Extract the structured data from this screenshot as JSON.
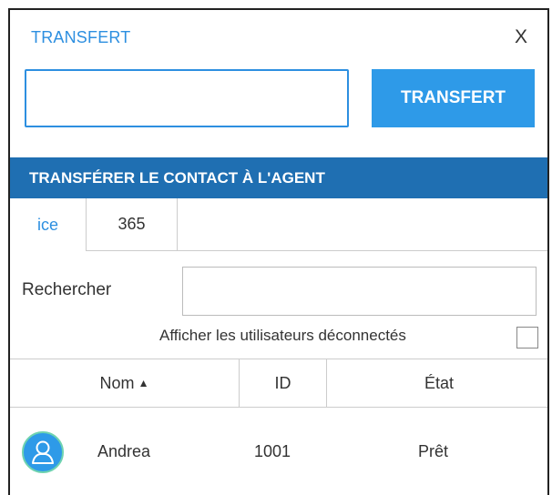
{
  "header": {
    "title": "TRANSFERT",
    "close_label": "X"
  },
  "transfer": {
    "input_value": "",
    "button_label": "TRANSFERT"
  },
  "section": {
    "title": "TRANSFÉRER LE CONTACT À L'AGENT"
  },
  "tabs": [
    {
      "label": "ice",
      "active": true
    },
    {
      "label": "365",
      "active": false
    }
  ],
  "search": {
    "label": "Rechercher",
    "value": ""
  },
  "show_disconnected": {
    "label": "Afficher les utilisateurs déconnectés",
    "checked": false
  },
  "table": {
    "columns": [
      "Nom",
      "ID",
      "État"
    ],
    "sort_indicator": "▲",
    "rows": [
      {
        "avatar_icon": "user-avatar-icon",
        "name": "Andrea",
        "id": "1001",
        "state": "Prêt"
      }
    ]
  },
  "colors": {
    "accent": "#2d8fe0",
    "button": "#2e9ae8",
    "section_bar": "#1f6fb2",
    "avatar_ring": "#6fd3b0"
  }
}
